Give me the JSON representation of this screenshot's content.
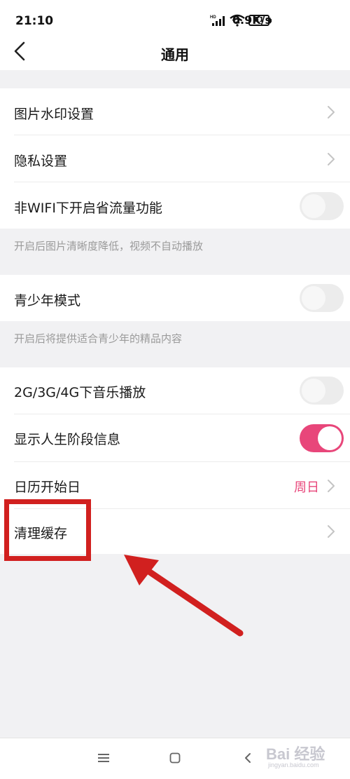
{
  "status_bar": {
    "time": "21:10",
    "speed": "0.9K/s",
    "battery": "51",
    "icons": [
      "hd-signal-icon",
      "wifi-icon",
      "battery-icon"
    ]
  },
  "header": {
    "title": "通用",
    "back_icon": "chevron-left-icon"
  },
  "settings": {
    "watermark": {
      "label": "图片水印设置"
    },
    "privacy": {
      "label": "隐私设置"
    },
    "data_saver": {
      "label": "非WIFI下开启省流量功能",
      "enabled": false,
      "hint": "开启后图片清晰度降低，视频不自动播放"
    },
    "teen_mode": {
      "label": "青少年模式",
      "enabled": false,
      "hint": "开启后将提供适合青少年的精品内容"
    },
    "music_mobile": {
      "label": "2G/3G/4G下音乐播放",
      "enabled": false
    },
    "life_stage": {
      "label": "显示人生阶段信息",
      "enabled": true
    },
    "week_start": {
      "label": "日历开始日",
      "value": "周日"
    },
    "clear_cache": {
      "label": "清理缓存"
    }
  },
  "bottom_nav": {
    "icons": [
      "menu-icon",
      "home-square-icon",
      "back-icon"
    ]
  },
  "watermark": {
    "text": "Bai 经验",
    "sub": "jingyan.baidu.com"
  },
  "colors": {
    "accent": "#e8467a",
    "annotation": "#d1201f",
    "background": "#f1f1f3"
  }
}
